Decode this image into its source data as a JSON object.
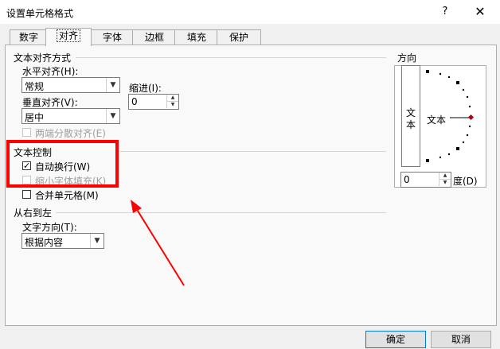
{
  "dialog": {
    "title": "设置单元格格式",
    "help_glyph": "?",
    "close_glyph": "✕"
  },
  "tabs": [
    {
      "label": "数字",
      "active": false
    },
    {
      "label": "对齐",
      "active": true
    },
    {
      "label": "字体",
      "active": false
    },
    {
      "label": "边框",
      "active": false
    },
    {
      "label": "填充",
      "active": false
    },
    {
      "label": "保护",
      "active": false
    }
  ],
  "text_alignment": {
    "group_label": "文本对齐方式",
    "horizontal_label": "水平对齐(H):",
    "horizontal_value": "常规",
    "indent_label": "缩进(I):",
    "indent_value": "0",
    "vertical_label": "垂直对齐(V):",
    "vertical_value": "居中",
    "justify_distributed_label": "两端分散对齐(E)"
  },
  "text_control": {
    "group_label": "文本控制",
    "wrap_text_label": "自动换行(W)",
    "wrap_text_checked": true,
    "shrink_to_fit_label": "缩小字体填充(K)",
    "shrink_to_fit_checked": false,
    "merge_cells_label": "合并单元格(M)",
    "merge_cells_checked": false
  },
  "rtl": {
    "group_label": "从右到左",
    "direction_label": "文字方向(T):",
    "direction_value": "根据内容"
  },
  "orientation": {
    "group_label": "方向",
    "vertical_text": "文本",
    "horizontal_text": "文本",
    "degrees_value": "0",
    "degrees_label": "度(D)"
  },
  "buttons": {
    "ok": "确定",
    "cancel": "取消"
  },
  "annotation": {
    "highlight_color": "#ff0000"
  }
}
